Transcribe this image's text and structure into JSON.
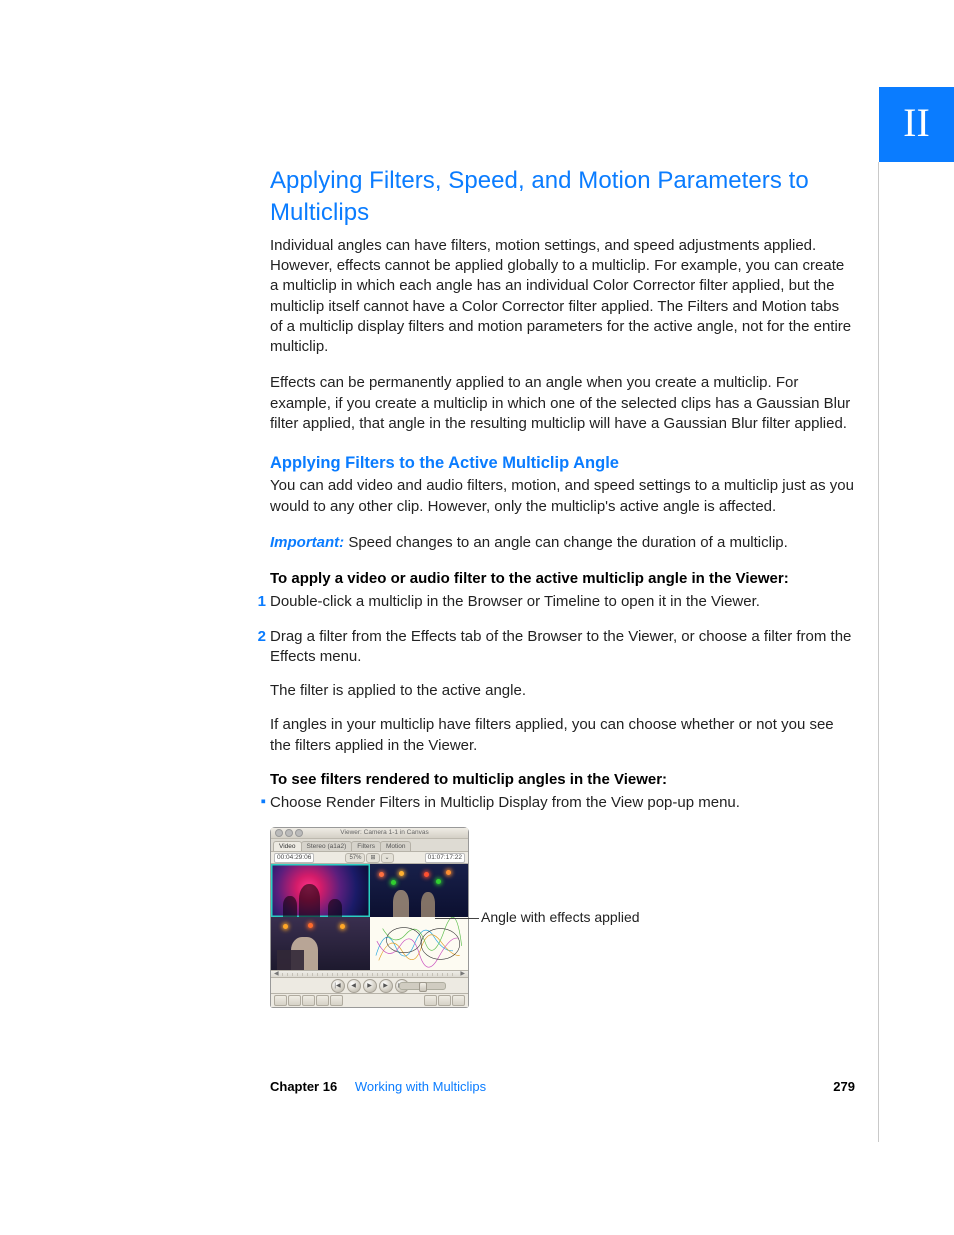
{
  "sideTab": "II",
  "section": {
    "title": "Applying Filters, Speed, and Motion Parameters to Multiclips",
    "p1": "Individual angles can have filters, motion settings, and speed adjustments applied. However, effects cannot be applied globally to a multiclip. For example, you can create a multiclip in which each angle has an individual Color Corrector filter applied, but the multiclip itself cannot have a Color Corrector filter applied. The Filters and Motion tabs of a multiclip display filters and motion parameters for the active angle, not for the entire multiclip.",
    "p2": "Effects can be permanently applied to an angle when you create a multiclip. For example, if you create a multiclip in which one of the selected clips has a Gaussian Blur filter applied, that angle in the resulting multiclip will have a Gaussian Blur filter applied."
  },
  "subsection": {
    "title": "Applying Filters to the Active Multiclip Angle",
    "p1": "You can add video and audio filters, motion, and speed settings to a multiclip just as you would to any other clip. However, only the multiclip's active angle is affected.",
    "importantLabel": "Important:",
    "importantText": "  Speed changes to an angle can change the duration of a multiclip.",
    "task1": "To apply a video or audio filter to the active multiclip angle in the Viewer:",
    "steps": [
      "Double-click a multiclip in the Browser or Timeline to open it in the Viewer.",
      "Drag a filter from the Effects tab of the Browser to the Viewer, or choose a filter from the Effects menu."
    ],
    "afterSteps1": "The filter is applied to the active angle.",
    "afterSteps2": "If angles in your multiclip have filters applied, you can choose whether or not you see the filters applied in the Viewer.",
    "task2": "To see filters rendered to multiclip angles in the Viewer:",
    "bullet1": "Choose Render Filters in Multiclip Display from the View pop-up menu.",
    "callout": "Angle with effects applied"
  },
  "viewer": {
    "title": "Viewer: Camera 1-1 in Canvas",
    "tabs": [
      "Video",
      "Stereo (a1a2)",
      "Filters",
      "Motion"
    ],
    "tcLeft": "00:04:29:06",
    "fit": "57%",
    "gridBtn": "⊞",
    "optBtn": "⌄",
    "tcRight": "01:07:17:22"
  },
  "footer": {
    "chapterLabel": "Chapter 16",
    "chapterTitle": "Working with Multiclips",
    "pageNumber": "279"
  }
}
